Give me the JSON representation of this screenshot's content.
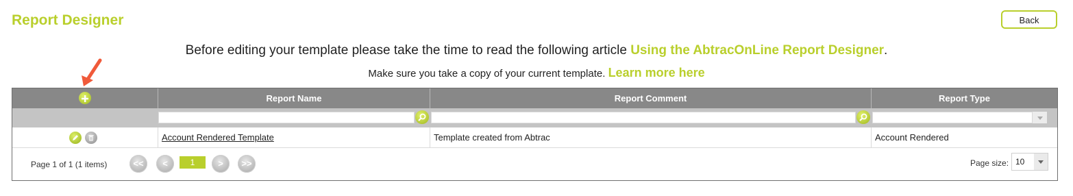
{
  "header": {
    "title": "Report Designer",
    "back_label": "Back"
  },
  "notice": {
    "line1_text": "Before editing your template please take the time to read the following article",
    "line1_link": "Using the AbtracOnLine Report Designer",
    "line1_end": ".",
    "line2_text": "Make sure you take a copy of your current template.",
    "line2_link": "Learn more here"
  },
  "grid": {
    "columns": [
      "",
      "Report Name",
      "Report Comment",
      "Report Type"
    ],
    "rows": [
      {
        "report_name": "Account Rendered Template",
        "report_comment": "Template created from Abtrac",
        "report_type": "Account Rendered"
      }
    ],
    "filters": {
      "report_name": "",
      "report_comment": "",
      "report_type": ""
    }
  },
  "pager": {
    "info": "Page 1 of 1 (1 items)",
    "first": "<<",
    "prev": "<",
    "current_page": "1",
    "next": ">",
    "last": ">>",
    "page_size_label": "Page size:",
    "page_size": "10"
  },
  "colors": {
    "accent": "#b9cf2c",
    "header_bg": "#888888",
    "filter_bg": "#c4c4c4",
    "arrow": "#f05a3a"
  }
}
